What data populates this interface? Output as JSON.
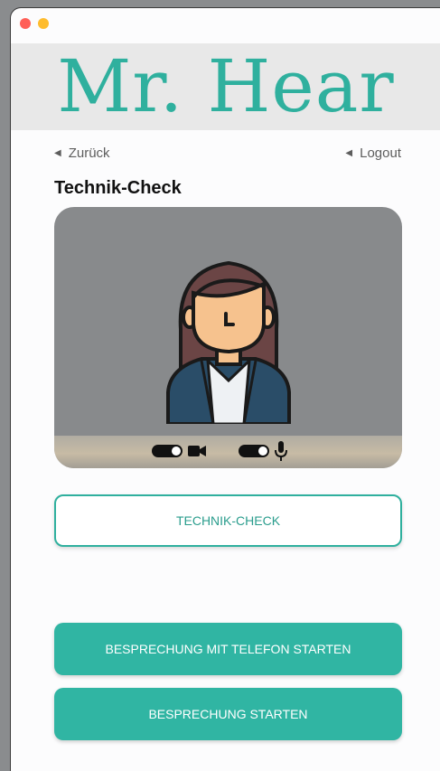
{
  "app": {
    "logo_text": "Mr. Hear"
  },
  "nav": {
    "back_label": "Zurück",
    "logout_label": "Logout"
  },
  "section": {
    "title": "Technik-Check"
  },
  "video": {
    "controls": [
      {
        "name": "camera",
        "icon": "video-camera-icon",
        "enabled": true
      },
      {
        "name": "microphone",
        "icon": "microphone-icon",
        "enabled": true
      }
    ]
  },
  "buttons": {
    "tech_check": "TECHNIK-CHECK",
    "start_phone": "BESPRECHUNG MIT TELEFON STARTEN",
    "start": "BESPRECHUNG STARTEN"
  },
  "colors": {
    "accent": "#30b5a3",
    "logo": "#2fb09e",
    "banner": "#e8e8e8"
  }
}
